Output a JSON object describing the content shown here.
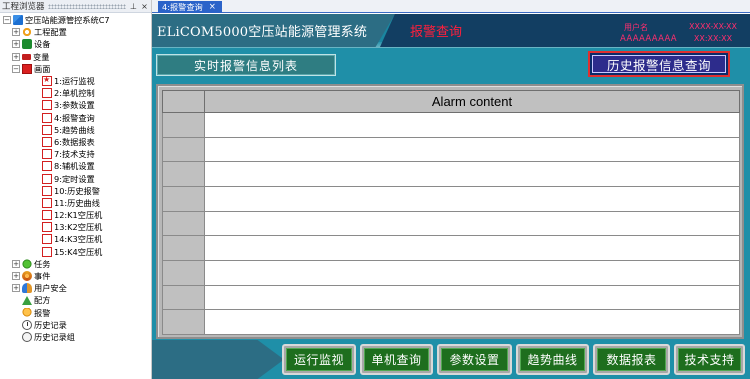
{
  "explorer": {
    "title": "工程浏览器",
    "pin_icon": "pin-icon",
    "close_icon": "close-icon",
    "tree": [
      {
        "label": "空压站能源管控系统C7",
        "icon": "project-root-icon",
        "expander": "⊟"
      },
      {
        "label": "工程配置",
        "icon": "gear-icon",
        "expander": "⊞"
      },
      {
        "label": "设备",
        "icon": "device-icon",
        "expander": "⊞"
      },
      {
        "label": "变量",
        "icon": "variable-icon",
        "expander": "⊞"
      },
      {
        "label": "画面",
        "icon": "screen-icon",
        "expander": "⊟"
      },
      {
        "label": "1:运行监视",
        "icon": "page-icon"
      },
      {
        "label": "2:单机控制",
        "icon": "page-icon"
      },
      {
        "label": "3:参数设置",
        "icon": "page-icon"
      },
      {
        "label": "4:报警查询",
        "icon": "page-icon"
      },
      {
        "label": "5:趋势曲线",
        "icon": "page-icon"
      },
      {
        "label": "6:数据报表",
        "icon": "page-icon"
      },
      {
        "label": "7:技术支持",
        "icon": "page-icon"
      },
      {
        "label": "8:辅机设置",
        "icon": "page-icon"
      },
      {
        "label": "9:定时设置",
        "icon": "page-icon"
      },
      {
        "label": "10:历史报警",
        "icon": "page-icon"
      },
      {
        "label": "11:历史曲线",
        "icon": "page-icon"
      },
      {
        "label": "12:K1空压机",
        "icon": "page-icon"
      },
      {
        "label": "13:K2空压机",
        "icon": "page-icon"
      },
      {
        "label": "14:K3空压机",
        "icon": "page-icon"
      },
      {
        "label": "15:K4空压机",
        "icon": "page-icon"
      },
      {
        "label": "任务",
        "icon": "task-icon",
        "expander": "⊞"
      },
      {
        "label": "事件",
        "icon": "event-icon",
        "expander": "⊞"
      },
      {
        "label": "用户安全",
        "icon": "users-icon",
        "expander": "⊞"
      },
      {
        "label": "配方",
        "icon": "recipe-icon"
      },
      {
        "label": "报警",
        "icon": "alarm-icon"
      },
      {
        "label": "历史记录",
        "icon": "history-icon"
      },
      {
        "label": "历史记录组",
        "icon": "history-group-icon"
      }
    ]
  },
  "tabs": [
    {
      "label": "4:报警查询",
      "close": "×"
    }
  ],
  "header": {
    "system_title": "ELiCOM5000空压站能源管理系统",
    "page_title": "报警查询",
    "user_label": "用户名",
    "user_name": "AAAAAAAAA",
    "date": "XXXX-XX-XX",
    "time": "XX:XX:XX"
  },
  "buttons": {
    "realtime_alarm_list": "实时报警信息列表",
    "history_alarm_query": "历史报警信息查询"
  },
  "alarm_table": {
    "header": "Alarm content",
    "rows": [
      "",
      "",
      "",
      "",
      "",
      "",
      "",
      "",
      ""
    ]
  },
  "nav": [
    {
      "id": "run-monitor",
      "label": "运行监视"
    },
    {
      "id": "single-query",
      "label": "单机查询"
    },
    {
      "id": "param-setting",
      "label": "参数设置"
    },
    {
      "id": "trend-curve",
      "label": "趋势曲线"
    },
    {
      "id": "data-report",
      "label": "数据报表"
    },
    {
      "id": "tech-support",
      "label": "技术支持"
    }
  ],
  "colors": {
    "screen_bg": "#1f8fa8",
    "alarm_text": "#ff1f3c",
    "nav_green": "#1e6e1e",
    "tab_blue": "#2b63c9"
  }
}
